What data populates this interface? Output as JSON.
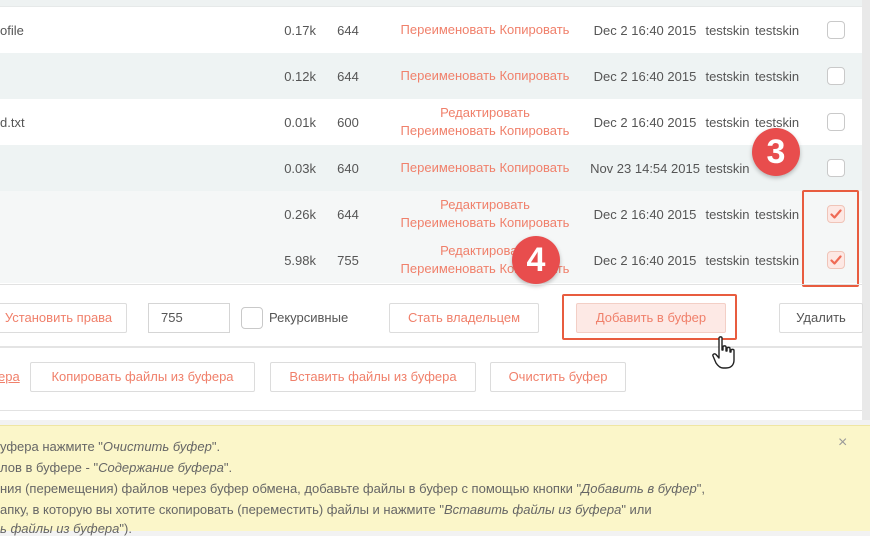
{
  "files": [
    {
      "name": "ofile",
      "size": "0.17k",
      "mode": "644",
      "actions": [
        "Переименовать Копировать"
      ],
      "date": "Dec 2 16:40 2015",
      "owner": "testskin",
      "group": "testskin",
      "checked": false,
      "alt": false
    },
    {
      "name": "",
      "size": "0.12k",
      "mode": "644",
      "actions": [
        "Переименовать Копировать"
      ],
      "date": "Dec 2 16:40 2015",
      "owner": "testskin",
      "group": "testskin",
      "checked": false,
      "alt": true
    },
    {
      "name": "d.txt",
      "size": "0.01k",
      "mode": "600",
      "actions": [
        "Редактировать",
        "Переименовать Копировать"
      ],
      "date": "Dec 2 16:40 2015",
      "owner": "testskin",
      "group": "testskin",
      "checked": false,
      "alt": false
    },
    {
      "name": "",
      "size": "0.03k",
      "mode": "640",
      "actions": [
        "Переименовать Копировать"
      ],
      "date": "Nov 23 14:54 2015",
      "owner": "testskin",
      "group": "",
      "checked": false,
      "alt": true
    },
    {
      "name": "",
      "size": "0.26k",
      "mode": "644",
      "actions": [
        "Редактировать",
        "Переименовать Копировать"
      ],
      "date": "Dec 2 16:40 2015",
      "owner": "testskin",
      "group": "testskin",
      "checked": true,
      "alt": false
    },
    {
      "name": "",
      "size": "5.98k",
      "mode": "755",
      "actions": [
        "Редактировать",
        "Переименовать Копировать"
      ],
      "date": "Dec 2 16:40 2015",
      "owner": "testskin",
      "group": "testskin",
      "checked": true,
      "alt": true
    }
  ],
  "toolbar": {
    "set_perms": "Установить права",
    "perm_value": "755",
    "recursive": "Рекурсивные",
    "owner": "Стать владельцем",
    "add_clipboard": "Добавить в буфер",
    "delete": "Удалить"
  },
  "clipboard": {
    "link": "ера",
    "copy": "Копировать файлы из буфера",
    "paste": "Вставить файлы из буфера",
    "clear": "Очистить буфер"
  },
  "badges": {
    "three": "3",
    "four": "4"
  },
  "notice": {
    "line1_a": "уфера нажмите \"",
    "line1_em": "Очистить буфер",
    "line1_b": "\".",
    "line2_a": "лов в буфере - \"",
    "line2_em": "Содержание буфера",
    "line2_b": "\".",
    "line3_a": "ния (перемещения) файлов через буфер обмена, добавьте файлы в буфер с помощью кнопки \"",
    "line3_em": "Добавить в буфер",
    "line3_b": "\",",
    "line4_a": "апку, в которую вы хотите скопировать (переместить) файлы и нажмите \"",
    "line4_em": "Вставить файлы из буфера",
    "line4_b": "\" или",
    "line5_em": "ь файлы из буфера",
    "line5_b": "\").",
    "close": "×"
  },
  "colors": {
    "accent": "#f0806b",
    "highlight": "#e85c3f",
    "badge": "#e84d4d",
    "notice_bg": "#fbf6c9"
  }
}
